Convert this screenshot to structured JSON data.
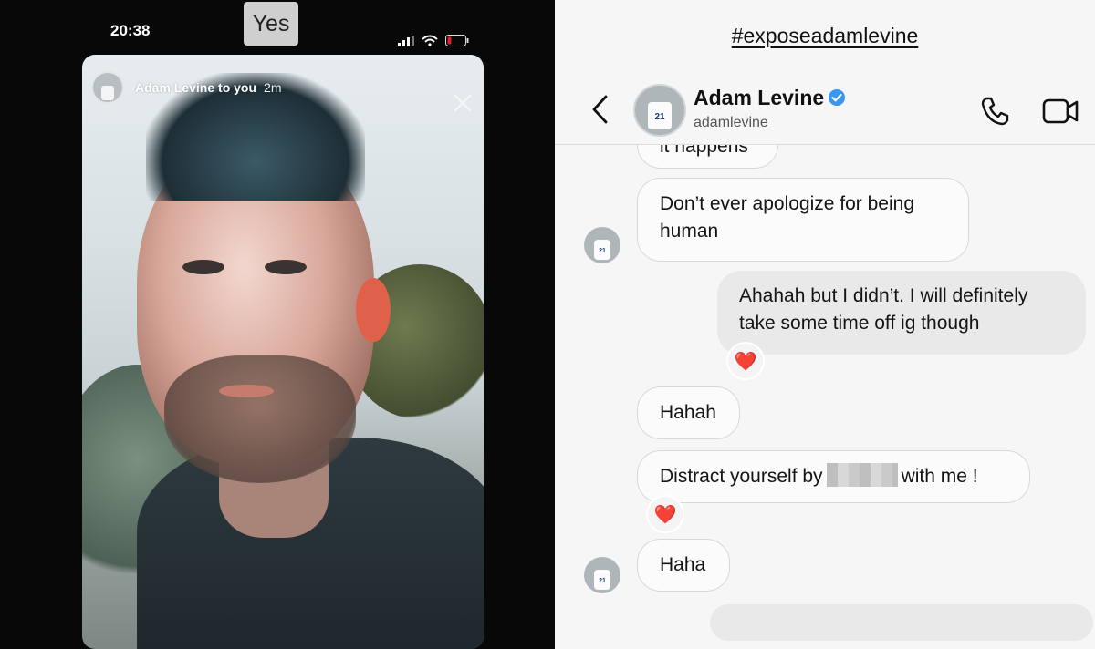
{
  "left": {
    "status_time": "20:38",
    "poll_answer": "Yes",
    "story": {
      "author_line": "Adam Levine to you",
      "time": "2m"
    }
  },
  "right": {
    "hashtag": "#exposeadamlevine",
    "header": {
      "name": "Adam Levine",
      "username": "adamlevine",
      "jersey_number": "21"
    },
    "messages": [
      {
        "from": "them",
        "text": "it happens"
      },
      {
        "from": "them",
        "text": "Don’t ever apologize for being human"
      },
      {
        "from": "me",
        "text": "Ahahah but I didn’t. I will definitely take some time off ig though",
        "reaction": "❤️"
      },
      {
        "from": "them",
        "text": "Hahah"
      },
      {
        "from": "them",
        "text_before": "Distract yourself by",
        "text_after": "with me !",
        "reaction": "❤️"
      },
      {
        "from": "them",
        "text": "Haha"
      }
    ],
    "colors": {
      "verified": "#3897f0",
      "heart": "#e0212d"
    }
  }
}
